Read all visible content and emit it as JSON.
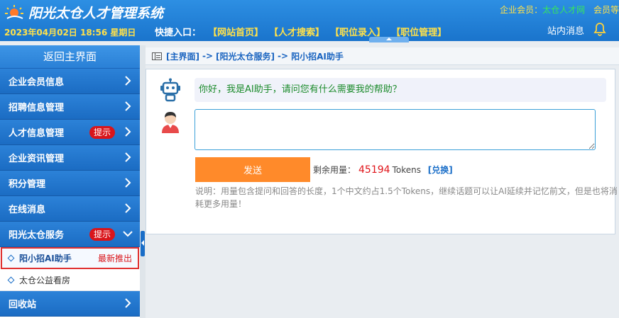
{
  "header": {
    "title": "阳光太仓人才管理系统",
    "datetime": "2023年04月02日 18:56 星期日",
    "quick_label": "快捷入口：",
    "quick_links": [
      "【网站首页】",
      "【人才搜索】",
      "【职位录入】",
      "【职位管理】"
    ],
    "member_label": "企业会员：",
    "member_name": "太仓人才网",
    "member_grade": "会员等",
    "messages": "站内消息",
    "colors": {
      "header_blue": "#1a74cc",
      "accent_yellow": "#ffe14a",
      "member_green": "#37e65b"
    }
  },
  "sidebar": {
    "back_main": "返回主界面",
    "items": [
      {
        "label": "企业会员信息"
      },
      {
        "label": "招聘信息管理"
      },
      {
        "label": "人才信息管理",
        "hint": "提示"
      },
      {
        "label": "企业资讯管理"
      },
      {
        "label": "积分管理"
      },
      {
        "label": "在线消息"
      },
      {
        "label": "阳光太仓服务",
        "hint": "提示",
        "expanded": true
      }
    ],
    "sub_items": [
      {
        "label": "阳小招AI助手",
        "tag": "最新推出",
        "active": true
      },
      {
        "label": "太仓公益看房"
      }
    ],
    "last_item": {
      "label": "回收站"
    }
  },
  "breadcrumb": {
    "home": "[主界面]",
    "sep": "->",
    "parent": "[阳光太仓服务]",
    "current": "阳小招AI助手"
  },
  "chat": {
    "bot_message": "你好，我是AI助手，请问您有什么需要我的帮助？",
    "input_value": "",
    "send_label": "发送",
    "usage_label": "剩余用量：",
    "tokens": "45194",
    "tokens_unit": "Tokens",
    "redeem_label": "[兑换]",
    "note": "说明：用量包含提问和回答的长度，1个中文约占1.5个Tokens，继续话题可以让AI延续并记忆前文，但是也将消耗更多用量！"
  },
  "icons": [
    "logo-sun-icon",
    "bell-icon",
    "chevron-right-icon",
    "chevron-down-icon",
    "diamond-bullet-icon",
    "breadcrumb-window-icon",
    "robot-icon",
    "user-avatar-icon"
  ]
}
